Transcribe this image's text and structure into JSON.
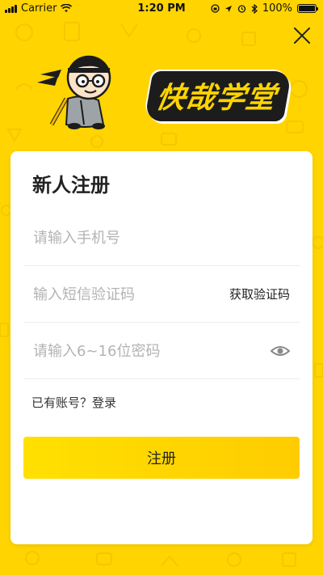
{
  "status_bar": {
    "carrier": "Carrier",
    "time": "1:20 PM",
    "battery": "100%"
  },
  "logo": {
    "text": "快哉学堂"
  },
  "form": {
    "title": "新人注册",
    "phone_placeholder": "请输入手机号",
    "sms_placeholder": "输入短信验证码",
    "get_code_label": "获取验证码",
    "password_placeholder": "请输入6~16位密码",
    "login_link": "已有账号？登录",
    "register_label": "注册"
  },
  "colors": {
    "background": "#FFD400",
    "button_start": "#FFE000",
    "button_end": "#FFCC00"
  }
}
